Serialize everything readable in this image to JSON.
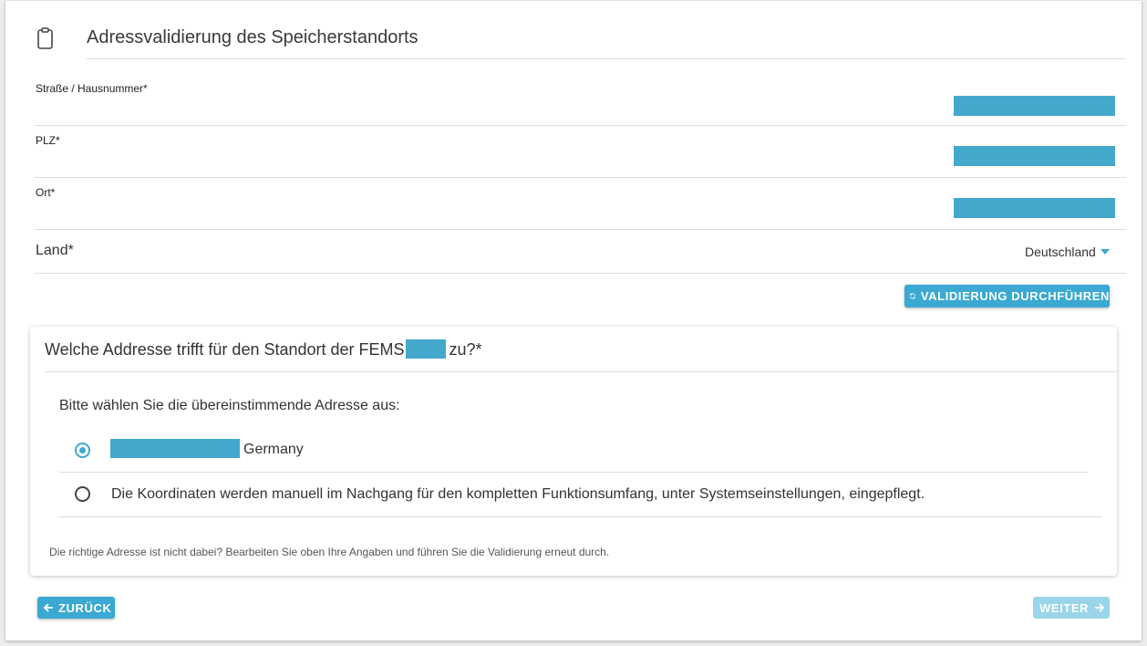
{
  "header": {
    "title": "Adressvalidierung des Speicherstandorts",
    "icon": "clipboard-icon"
  },
  "fields": [
    {
      "label": "Straße / Hausnummer*"
    },
    {
      "label": "PLZ*"
    },
    {
      "label": "Ort*"
    }
  ],
  "land": {
    "label": "Land*",
    "value": "Deutschland"
  },
  "buttons": {
    "validate": "VALIDIERUNG DURCHFÜHREN",
    "back": "ZURÜCK",
    "next": "WEITER"
  },
  "question": {
    "title_prefix": "Welche Addresse trifft für den Standort der FEMS",
    "title_suffix": "zu?*",
    "prompt": "Bitte wählen Sie die übereinstimmende Adresse aus:",
    "options": [
      {
        "text": "Germany",
        "selected": true
      },
      {
        "text": "Die Koordinaten werden manuell im Nachgang für den kompletten Funktionsumfang, unter Systemseinstellungen, eingepflegt.",
        "selected": false
      }
    ],
    "hint": "Die richtige Adresse ist nicht dabei? Bearbeiten Sie oben Ihre Angaben und führen Sie die Validierung erneut durch."
  },
  "colors": {
    "accent": "#3ba9d1",
    "redaction": "#44a8cc",
    "disabled": "#9ad5ea"
  }
}
